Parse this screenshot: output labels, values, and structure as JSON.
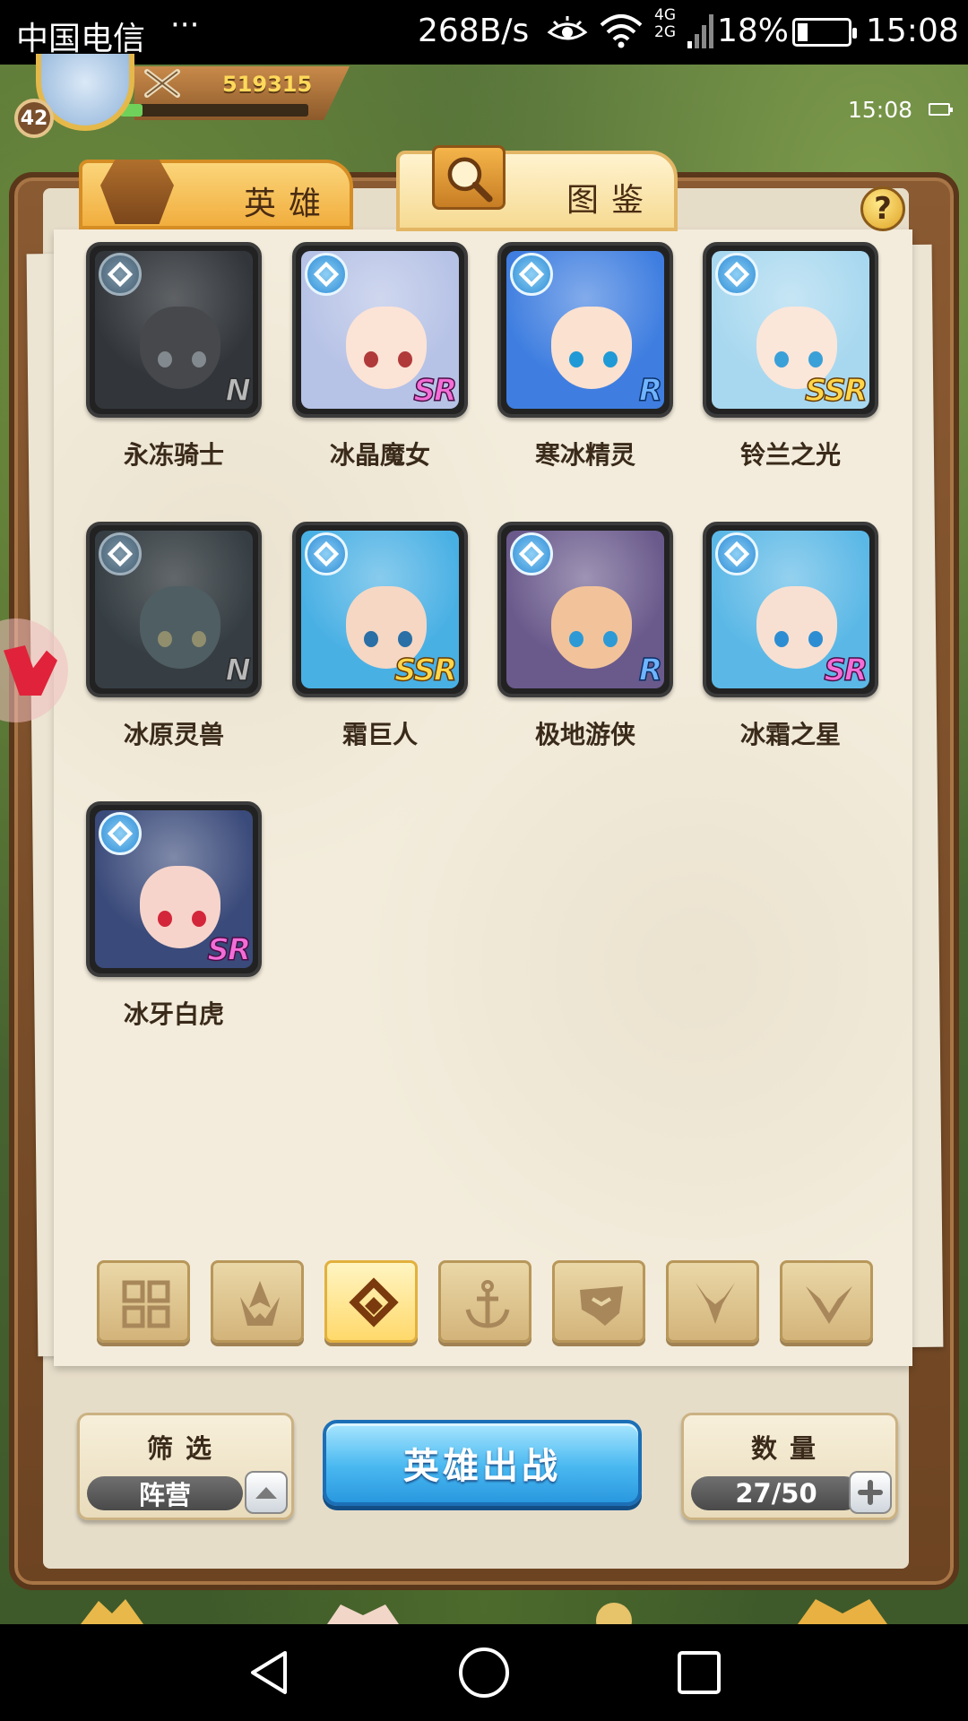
{
  "status_bar": {
    "carrier": "中国电信",
    "more": "···",
    "speed": "268B/s",
    "network_top": "4G",
    "network_bottom": "2G",
    "battery": "18%",
    "time": "15:08"
  },
  "player": {
    "level": "42",
    "power": "519315",
    "game_time": "15:08"
  },
  "tabs": [
    {
      "label": "英雄",
      "icon": "helmet-icon",
      "active": false
    },
    {
      "label": "图鉴",
      "icon": "magnifier-icon",
      "active": true
    }
  ],
  "help": {
    "label": "?"
  },
  "heroes": [
    {
      "name": "永冻骑士",
      "rarity": "N",
      "locked": true,
      "bg": "#3e4f63",
      "face": "#5e6874",
      "eye": "#a9c6e0"
    },
    {
      "name": "冰晶魔女",
      "rarity": "SR",
      "locked": false,
      "bg": "#b6c2e6",
      "face": "#fbe3d6",
      "eye": "#b03a3a"
    },
    {
      "name": "寒冰精灵",
      "rarity": "R",
      "locked": false,
      "bg": "#3f7ee0",
      "face": "#fbe1cf",
      "eye": "#1f9ad6"
    },
    {
      "name": "铃兰之光",
      "rarity": "SSR",
      "locked": false,
      "bg": "#a8d8ef",
      "face": "#fbe6da",
      "eye": "#3aa0d8"
    },
    {
      "name": "冰原灵兽",
      "rarity": "N",
      "locked": true,
      "bg": "#3a5d72",
      "face": "#4f8fa0",
      "eye": "#d9d04a"
    },
    {
      "name": "霜巨人",
      "rarity": "SSR",
      "locked": false,
      "bg": "#49b0e4",
      "face": "#f5d7c4",
      "eye": "#2a6fa5"
    },
    {
      "name": "极地游侠",
      "rarity": "R",
      "locked": false,
      "bg": "#6a5a8c",
      "face": "#f2c39a",
      "eye": "#2d9ad6"
    },
    {
      "name": "冰霜之星",
      "rarity": "SR",
      "locked": false,
      "bg": "#5bb8e6",
      "face": "#f7e0d2",
      "eye": "#2d8dd2"
    },
    {
      "name": "冰牙白虎",
      "rarity": "SR",
      "locked": false,
      "bg": "#3a4a7a",
      "face": "#f6d4cb",
      "eye": "#d3263a"
    }
  ],
  "faction_filters": [
    {
      "name": "all",
      "icon": "grid-icon",
      "active": false
    },
    {
      "name": "flame",
      "icon": "flame-icon",
      "active": false
    },
    {
      "name": "ice",
      "icon": "ice-crystal-icon",
      "active": true
    },
    {
      "name": "ocean",
      "icon": "anchor-icon",
      "active": false
    },
    {
      "name": "beast",
      "icon": "beast-head-icon",
      "active": false
    },
    {
      "name": "dark",
      "icon": "demon-horns-icon",
      "active": false
    },
    {
      "name": "light",
      "icon": "wings-icon",
      "active": false
    }
  ],
  "controls": {
    "filter_caption": "筛选",
    "filter_value": "阵营",
    "deploy_label": "英雄出战",
    "count_caption": "数量",
    "count_value": "27/50"
  },
  "colors": {
    "accent_blue": "#49b8f0",
    "tab_orange": "#f1ae3e",
    "paper": "#f3ecdc",
    "wood": "#6d4422"
  }
}
